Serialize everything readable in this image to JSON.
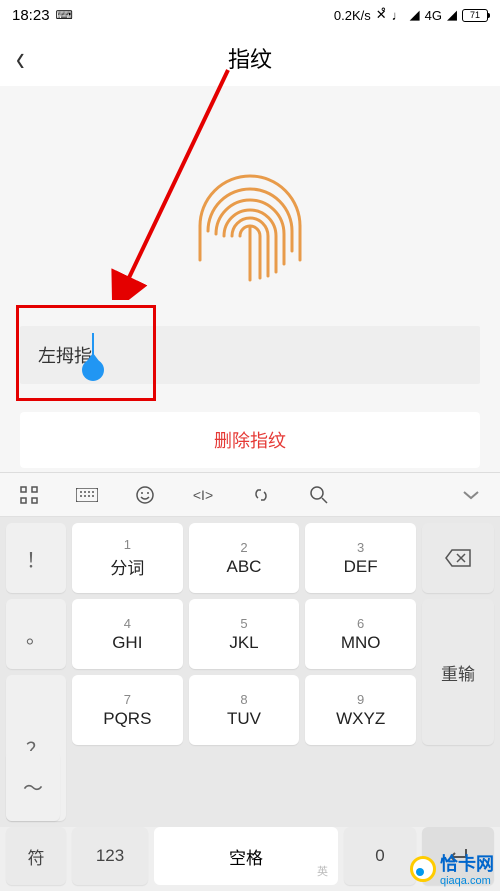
{
  "status_bar": {
    "time": "18:23",
    "speed": "0.2K/s",
    "network_label": "4G",
    "battery_text": "71"
  },
  "header": {
    "title": "指纹"
  },
  "content": {
    "fingerprint_name_value": "左拇指",
    "delete_label": "删除指纹"
  },
  "keyboard": {
    "rows": [
      {
        "side": "！",
        "k1_num": "1",
        "k1_lbl": "分词",
        "k2_num": "2",
        "k2_lbl": "ABC",
        "k3_num": "3",
        "k3_lbl": "DEF",
        "fn": "backspace"
      },
      {
        "side": "。",
        "k1_num": "4",
        "k1_lbl": "GHI",
        "k2_num": "5",
        "k2_lbl": "JKL",
        "k3_num": "6",
        "k3_lbl": "MNO",
        "fn_lbl": "重输"
      },
      {
        "side": "？",
        "k1_num": "7",
        "k1_lbl": "PQRS",
        "k2_num": "8",
        "k2_lbl": "TUV",
        "k3_num": "9",
        "k3_lbl": "WXYZ",
        "fn_lbl": "0"
      },
      {
        "side": "～"
      }
    ],
    "bottom": {
      "sym": "符",
      "num": "123",
      "space": "空格",
      "space_lang": "英"
    }
  },
  "watermark": {
    "name": "恰卡网",
    "url": "qiaqa.com"
  }
}
